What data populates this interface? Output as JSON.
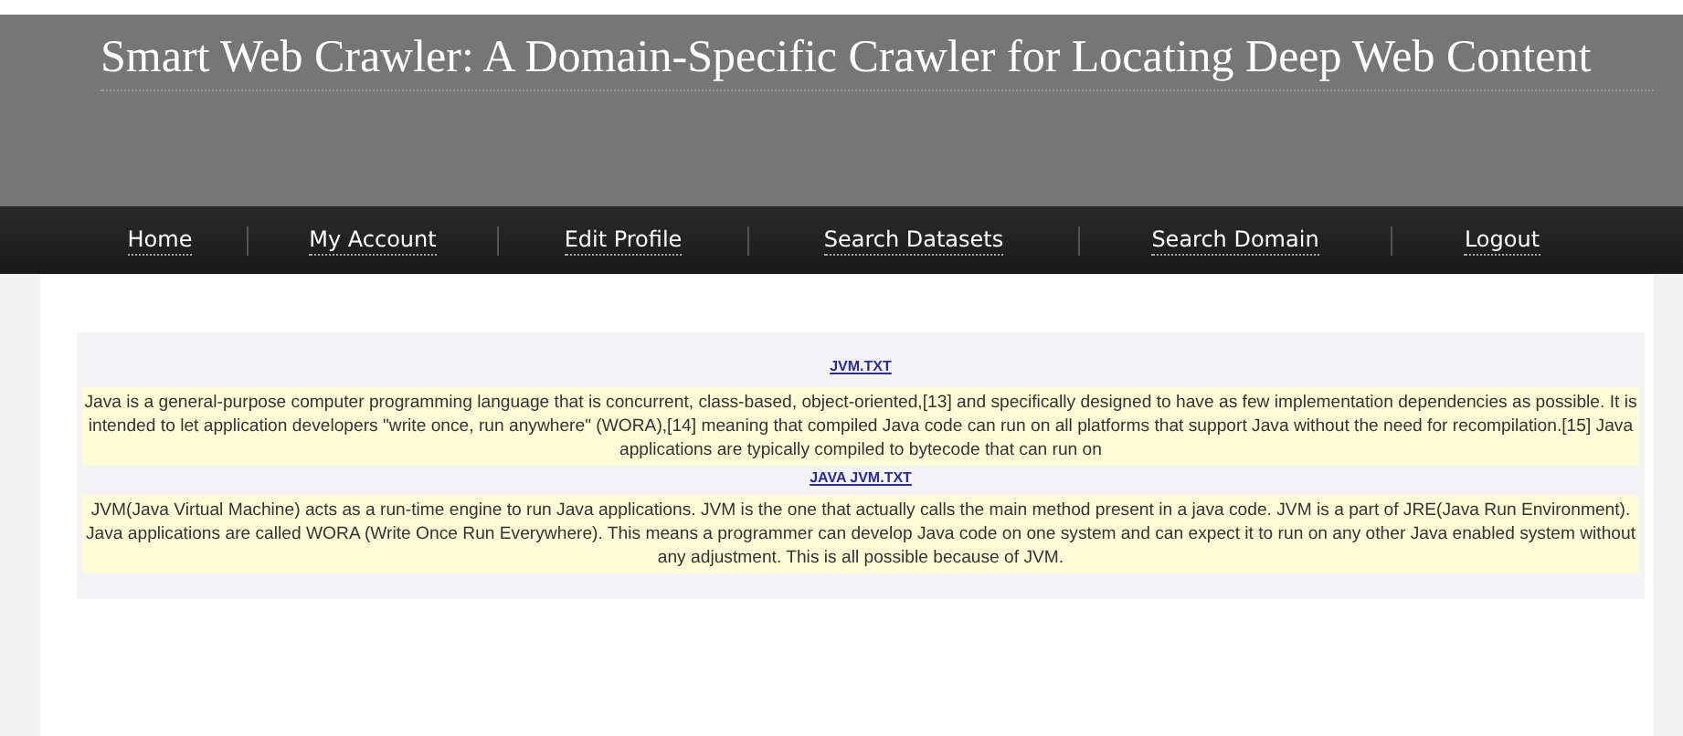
{
  "header": {
    "title": "Smart Web Crawler: A Domain-Specific Crawler for Locating Deep Web Content"
  },
  "nav": [
    {
      "label": "Home"
    },
    {
      "label": "My Account"
    },
    {
      "label": "Edit Profile"
    },
    {
      "label": "Search Datasets"
    },
    {
      "label": "Search Domain"
    },
    {
      "label": "Logout"
    }
  ],
  "results": [
    {
      "file": "JVM.TXT",
      "excerpt": "Java is a general-purpose computer programming language that is concurrent, class-based, object-oriented,[13] and specifically designed to have as few implementation dependencies as possible. It is intended to let application developers \"write once, run anywhere\" (WORA),[14] meaning that compiled Java code can run on all platforms that support Java without the need for recompilation.[15] Java applications are typically compiled to bytecode that can run on"
    },
    {
      "file": "JAVA JVM.TXT",
      "excerpt": "JVM(Java Virtual Machine) acts as a run-time engine to run Java applications. JVM is the one that actually calls the main method present in a java code. JVM is a part of JRE(Java Run Environment). Java applications are called WORA (Write Once Run Everywhere). This means a programmer can develop Java code on one system and can expect it to run on any other Java enabled system without any adjustment. This is all possible because of JVM."
    }
  ]
}
